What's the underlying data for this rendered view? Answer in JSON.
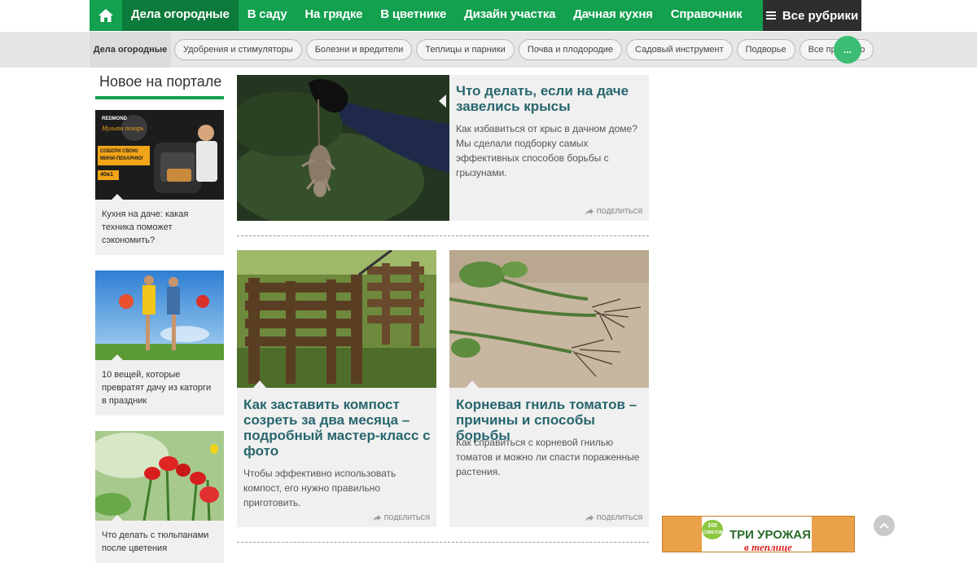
{
  "nav": {
    "items": [
      "Дела огородные",
      "В саду",
      "На грядке",
      "В цветнике",
      "Дизайн участка",
      "Дачная кухня",
      "Справочник"
    ],
    "all_rubrics": "Все рубрики"
  },
  "subnav": {
    "title": "Дела огородные",
    "pills": [
      "Удобрения и стимуляторы",
      "Болезни и вредители",
      "Теплицы и парники",
      "Почва и плодородие",
      "Садовый инструмент",
      "Подворье",
      "Все про баню"
    ],
    "more": "..."
  },
  "sidebar": {
    "heading": "Новое на портале",
    "items": [
      {
        "caption": "Кухня на даче: какая техника поможет сэкономить?",
        "ad_brand": "REDMOND",
        "ad_title": "Мульти пекарь",
        "ad_slogan": "СОБЕРИ СВОЮ МИНИ-ПЕКАРНЮ!",
        "ad_badge": "40в1"
      },
      {
        "caption": "10 вещей, которые превратят дачу из каторги в праздник"
      },
      {
        "caption": "Что делать с тюльпанами после цветения"
      }
    ]
  },
  "cards": [
    {
      "title": "Что делать, если на даче завелись крысы",
      "desc": "Как избавиться от крыс в дачном доме? Мы сделали подборку самых эффективных способов борьбы с грызунами.",
      "share": "Поделиться"
    },
    {
      "title": "Как заставить компост созреть за два месяца – подробный мастер-класс с фото",
      "desc": "Чтобы эффективно использовать компост, его нужно правильно приготовить.",
      "share": "Поделиться"
    },
    {
      "title": "Корневая гниль томатов – причины и способы борьбы",
      "desc": "Как справиться с корневой гнилью томатов и можно ли спасти пораженные растения.",
      "share": "Поделиться"
    }
  ],
  "ad": {
    "badge": "100",
    "badge_sub": "СОВЕТОВ",
    "title": "ТРИ УРОЖАЯ",
    "subtitle": "в теплице"
  },
  "colors": {
    "brand_green": "#13a04f",
    "title_teal": "#28666e",
    "dark": "#2e2e2e"
  }
}
